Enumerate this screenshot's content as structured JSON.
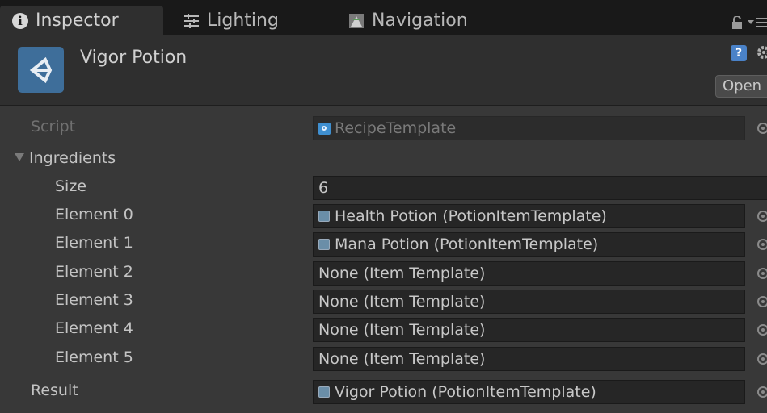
{
  "tabs": [
    {
      "label": "Inspector",
      "icon": "info-icon",
      "active": true
    },
    {
      "label": "Lighting",
      "icon": "lighting-icon",
      "active": false
    },
    {
      "label": "Navigation",
      "icon": "navigation-icon",
      "active": false
    }
  ],
  "header": {
    "title": "Vigor Potion",
    "open_label": "Open",
    "help_glyph": "?"
  },
  "script": {
    "label": "Script",
    "value": "RecipeTemplate"
  },
  "ingredients": {
    "label": "Ingredients",
    "size_label": "Size",
    "size_value": "6",
    "elements": [
      {
        "label": "Element 0",
        "value": "Health Potion (PotionItemTemplate)",
        "has_icon": true
      },
      {
        "label": "Element 1",
        "value": "Mana Potion (PotionItemTemplate)",
        "has_icon": true
      },
      {
        "label": "Element 2",
        "value": "None (Item Template)",
        "has_icon": false
      },
      {
        "label": "Element 3",
        "value": "None (Item Template)",
        "has_icon": false
      },
      {
        "label": "Element 4",
        "value": "None (Item Template)",
        "has_icon": false
      },
      {
        "label": "Element 5",
        "value": "None (Item Template)",
        "has_icon": false
      }
    ]
  },
  "result": {
    "label": "Result",
    "value": "Vigor Potion (PotionItemTemplate)"
  },
  "colors": {
    "panel_bg": "#383838",
    "tabbar_bg": "#191919",
    "field_bg": "#262626",
    "accent": "#4a82c8"
  }
}
